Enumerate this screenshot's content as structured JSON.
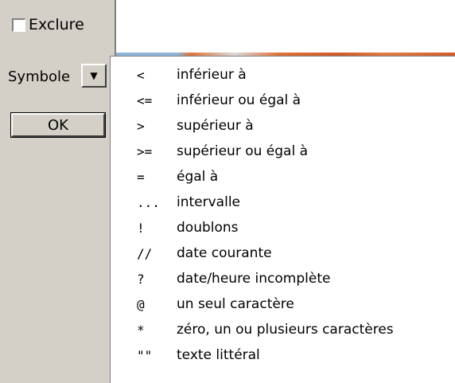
{
  "options": {
    "exclude_label": "Exclure",
    "exclude_checked": false,
    "symbol_label": "Symbole",
    "ok_label": "OK"
  },
  "dropdown_icon": "chevron-down-icon",
  "menu": {
    "items": [
      {
        "symbol": "<",
        "label": "inférieur à"
      },
      {
        "symbol": "<=",
        "label": "inférieur ou égal à"
      },
      {
        "symbol": ">",
        "label": "supérieur à"
      },
      {
        "symbol": ">=",
        "label": "supérieur ou égal à"
      },
      {
        "symbol": "=",
        "label": "égal à"
      },
      {
        "symbol": "...",
        "label": "intervalle"
      },
      {
        "symbol": "!",
        "label": "doublons"
      },
      {
        "symbol": "//",
        "label": "date courante"
      },
      {
        "symbol": "?",
        "label": "date/heure incomplète"
      },
      {
        "symbol": "@",
        "label": "un seul caractère"
      },
      {
        "symbol": "*",
        "label": "zéro, un ou plusieurs caractères"
      },
      {
        "symbol": "\"\"",
        "label": "texte littéral"
      }
    ]
  }
}
